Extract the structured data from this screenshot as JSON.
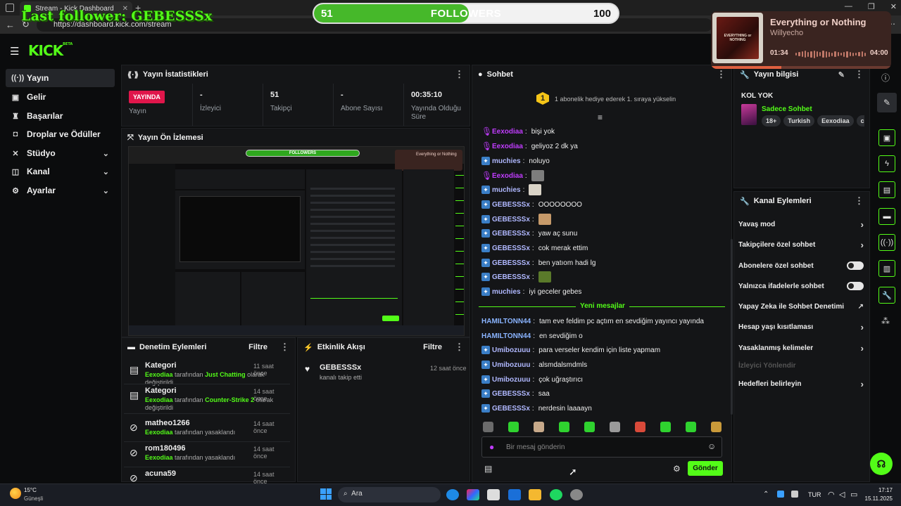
{
  "browser": {
    "tab_title": "Stream - Kick Dashboard",
    "url": "https://dashboard.kick.com/stream"
  },
  "overlay": {
    "last_follower": "Last follower: GEBESSSx",
    "goal": {
      "current": "51",
      "title": "FOLLOWERS",
      "target": "100",
      "progress": 0.51
    },
    "music": {
      "title": "Everything or Nothing",
      "artist": "Willyecho",
      "elapsed": "01:34",
      "duration": "04:00",
      "progress": 0.39,
      "album_text": "EVERYTHING or NOTHING"
    }
  },
  "app": {
    "logo": "KICK",
    "logo_sup": "BETA"
  },
  "sidebar": {
    "items": [
      {
        "label": "Yayın",
        "icon": "broadcast-icon",
        "active": true
      },
      {
        "label": "Gelir",
        "icon": "wallet-icon"
      },
      {
        "label": "Başarılar",
        "icon": "trophy-icon"
      },
      {
        "label": "Droplar ve Ödüller",
        "icon": "gift-icon"
      },
      {
        "label": "Stüdyo",
        "icon": "studio-icon",
        "expandable": true
      },
      {
        "label": "Kanal",
        "icon": "channel-icon",
        "expandable": true
      },
      {
        "label": "Ayarlar",
        "icon": "gear-icon",
        "expandable": true
      }
    ]
  },
  "stats": {
    "title": "Yayın İstatistikleri",
    "live_badge": "YAYINDA",
    "cells": [
      {
        "value": "",
        "label": "Yayın"
      },
      {
        "value": "-",
        "label": "İzleyici"
      },
      {
        "value": "51",
        "label": "Takipçi"
      },
      {
        "value": "-",
        "label": "Abone Sayısı"
      },
      {
        "value": "00:35:10",
        "label": "Yayında Olduğu Süre"
      }
    ]
  },
  "preview": {
    "title": "Yayın Ön İzlemesi",
    "mini_followers": "FOLLOWERS",
    "mini_song": "Everything or Nothing"
  },
  "moderation": {
    "title": "Denetim Eylemleri",
    "filter": "Filtre",
    "rows": [
      {
        "title": "Kategori",
        "actor": "Eexodiaa",
        "middle": " tarafından ",
        "target": "Just Chatting",
        "suffix": " olarak değiştirildi",
        "time": "11 saat önce",
        "icon": "category-icon"
      },
      {
        "title": "Kategori",
        "actor": "Eexodiaa",
        "middle": " tarafından ",
        "target": "Counter-Strike 2",
        "suffix": " olarak değiştirildi",
        "time": "14 saat önce",
        "icon": "category-icon"
      },
      {
        "title": "matheo1266",
        "actor": "Eexodiaa",
        "middle": " tarafından yasaklandı",
        "target": "",
        "suffix": "",
        "time": "14 saat önce",
        "icon": "ban-icon"
      },
      {
        "title": "rom180496",
        "actor": "Eexodiaa",
        "middle": " tarafından yasaklandı",
        "target": "",
        "suffix": "",
        "time": "14 saat önce",
        "icon": "ban-icon"
      },
      {
        "title": "acuna59",
        "actor": "",
        "middle": "",
        "target": "",
        "suffix": "",
        "time": "14 saat önce",
        "icon": "ban-icon"
      }
    ]
  },
  "activity": {
    "title": "Etkinlik Akışı",
    "filter": "Filtre",
    "rows": [
      {
        "title": "GEBESSSx",
        "sub": "kanalı takip etti",
        "time": "12 saat önce"
      }
    ]
  },
  "chat": {
    "title": "Sohbet",
    "sub_goal": "1 abonelik hediye ederek 1. sıraya yükselin",
    "sub_goal_rank": "1",
    "new_messages": "Yeni mesajlar",
    "input_placeholder": "Bir mesaj gönderin",
    "send": "Gönder",
    "colors": {
      "purple": "#c13cff",
      "blue": "#8ab4ff",
      "green": "#53fc18"
    },
    "messages": [
      {
        "user": "Eexodiaa",
        "badge": "mic",
        "color": "#c13cff",
        "text": "bişi yok"
      },
      {
        "user": "Eexodiaa",
        "badge": "mic",
        "color": "#c13cff",
        "text": "geliyoz 2 dk ya"
      },
      {
        "user": "muchies",
        "badge": "bot",
        "color": "#b0b8ff",
        "text": "noluyo"
      },
      {
        "user": "Eexodiaa",
        "badge": "mic",
        "color": "#c13cff",
        "text": "",
        "emote": "#7d7d7d"
      },
      {
        "user": "muchies",
        "badge": "bot",
        "color": "#b0b8ff",
        "text": "",
        "emote": "#d9d3c7"
      },
      {
        "user": "GEBESSSx",
        "badge": "bot",
        "color": "#b0b8ff",
        "text": "OOOOOOOO"
      },
      {
        "user": "GEBESSSx",
        "badge": "bot",
        "color": "#b0b8ff",
        "text": "",
        "emote": "#c69a6a"
      },
      {
        "user": "GEBESSSx",
        "badge": "bot",
        "color": "#b0b8ff",
        "text": "yaw aç sunu"
      },
      {
        "user": "GEBESSSx",
        "badge": "bot",
        "color": "#b0b8ff",
        "text": "cok merak ettim"
      },
      {
        "user": "GEBESSSx",
        "badge": "bot",
        "color": "#b0b8ff",
        "text": "ben yatıom hadi lg"
      },
      {
        "user": "GEBESSSx",
        "badge": "bot",
        "color": "#b0b8ff",
        "text": "",
        "emote": "#5a7a2a"
      },
      {
        "user": "muchies",
        "badge": "bot",
        "color": "#b0b8ff",
        "text": "iyi geceler gebes"
      },
      {
        "user": "HAMILTONN44",
        "badge": "",
        "color": "#8ab4ff",
        "text": "tam eve feldim pc açtım en sevdiğim yayıncı yayında"
      },
      {
        "user": "HAMILTONN44",
        "badge": "",
        "color": "#8ab4ff",
        "text": "en sevdiğim o"
      },
      {
        "user": "Umibozuuu",
        "badge": "bot",
        "color": "#b0b8ff",
        "text": "para verseler kendim için liste yapmam"
      },
      {
        "user": "Umibozuuu",
        "badge": "bot",
        "color": "#b0b8ff",
        "text": "alsmdalsmdmls"
      },
      {
        "user": "Umibozuuu",
        "badge": "bot",
        "color": "#b0b8ff",
        "text": "çok uğraştırıcı"
      },
      {
        "user": "GEBESSSx",
        "badge": "bot",
        "color": "#b0b8ff",
        "text": "saa"
      },
      {
        "user": "GEBESSSx",
        "badge": "bot",
        "color": "#b0b8ff",
        "text": "nerdesin laaaayn"
      }
    ],
    "emote_bar": [
      "#6b6b6b",
      "#2fd22f",
      "#c7a98a",
      "#2fd22f",
      "#2fd22f",
      "#9a9a9a",
      "#d94a3a",
      "#2fd22f",
      "#2fd22f",
      "#c99a3a"
    ]
  },
  "stream_info": {
    "title": "Yayın bilgisi",
    "stream_title": "KOL YOK",
    "category": "Sadece Sohbet",
    "tags": [
      "18+",
      "Turkish",
      "Eexodiaa",
      "chi"
    ]
  },
  "channel_actions": {
    "title": "Kanal Eylemleri",
    "rows": [
      {
        "label": "Yavaş mod",
        "type": "chevron"
      },
      {
        "label": "Takipçilere özel sohbet",
        "type": "chevron"
      },
      {
        "label": "Abonelere özel sohbet",
        "type": "toggle"
      },
      {
        "label": "Yalnızca ifadelerle sohbet",
        "type": "toggle"
      },
      {
        "label": "Yapay Zeka ile Sohbet Denetimi",
        "type": "external"
      },
      {
        "label": "Hesap yaşı kısıtlaması",
        "type": "chevron"
      },
      {
        "label": "Yasaklanmış kelimeler",
        "type": "chevron"
      },
      {
        "label": "İzleyici Yönlendir",
        "type": "disabled"
      },
      {
        "label": "Hedefleri belirleyin",
        "type": "chevron"
      }
    ]
  },
  "taskbar": {
    "weather_temp": "15°C",
    "weather_desc": "Güneşli",
    "search": "Ara",
    "lang": "TUR",
    "time": "17:17",
    "date": "15.11.2025"
  }
}
